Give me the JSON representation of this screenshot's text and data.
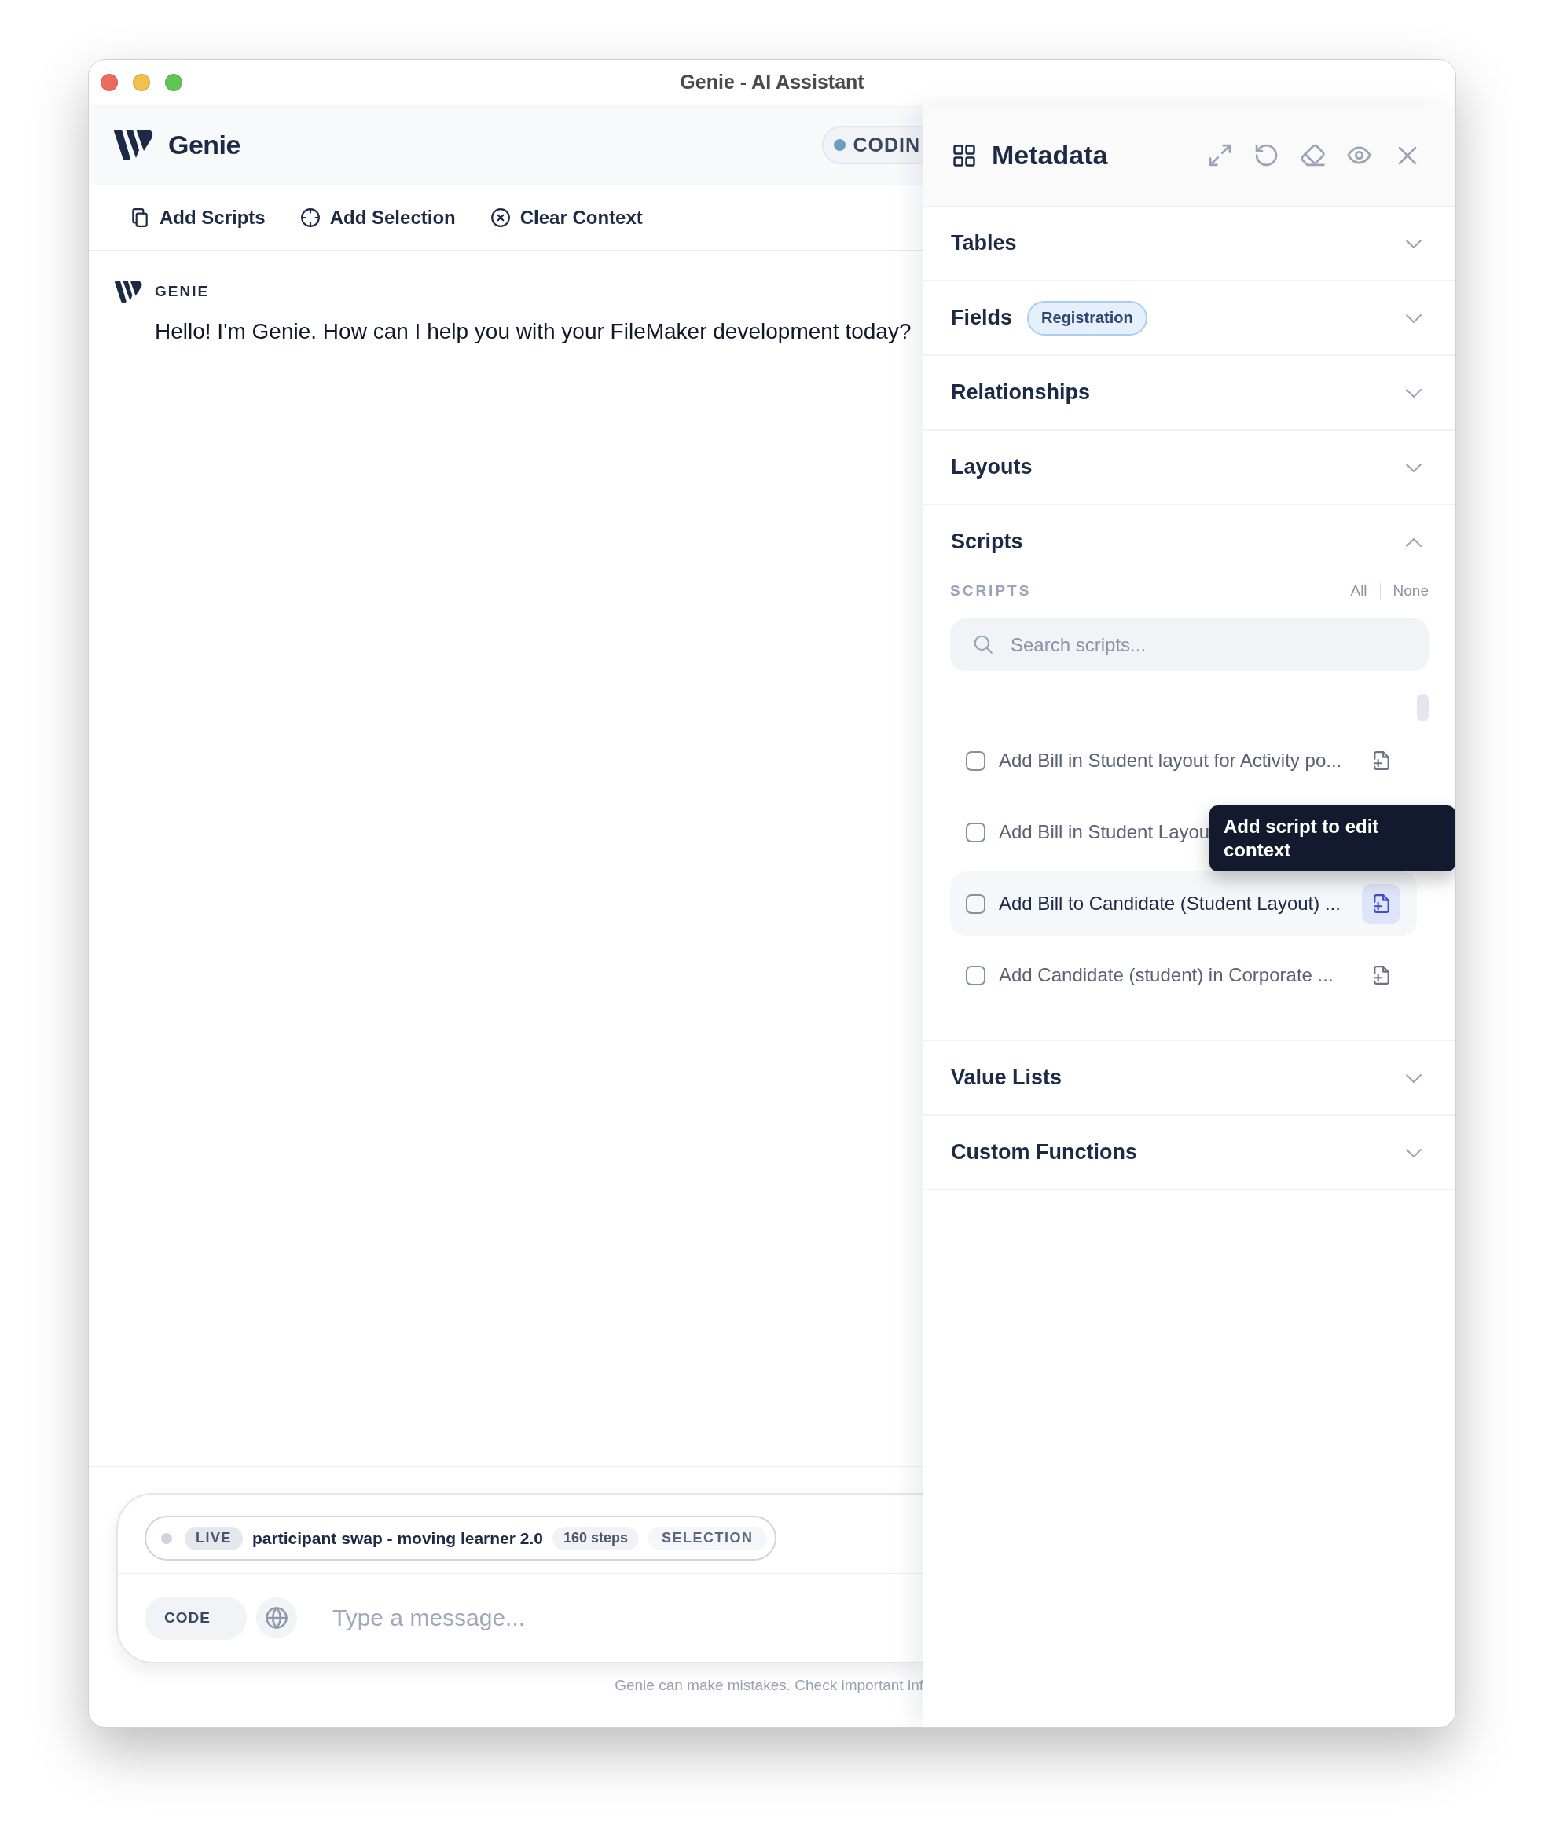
{
  "window": {
    "title": "Genie - AI Assistant"
  },
  "header": {
    "app_name": "Genie",
    "mode_badge": "CODIN"
  },
  "toolbar": [
    {
      "kind": "scripts",
      "label": "Add Scripts"
    },
    {
      "kind": "selection",
      "label": "Add Selection"
    },
    {
      "kind": "clear",
      "label": "Clear Context"
    }
  ],
  "messages": [
    {
      "sender": "GENIE",
      "text": "Hello! I'm Genie. How can I help you with your FileMaker development today?"
    }
  ],
  "composer": {
    "context": {
      "status": "LIVE",
      "name": "participant swap - moving learner 2.0",
      "steps": "160 steps",
      "mode": "SELECTION"
    },
    "mode_button": "CODE",
    "placeholder": "Type a message...",
    "disclaimer": "Genie can make mistakes. Check important inf"
  },
  "metadata_panel": {
    "title": "Metadata",
    "sections": [
      {
        "title": "Tables",
        "expanded": false
      },
      {
        "title": "Fields",
        "badge": "Registration",
        "expanded": false
      },
      {
        "title": "Relationships",
        "expanded": false
      },
      {
        "title": "Layouts",
        "expanded": false
      },
      {
        "title": "Scripts",
        "expanded": true,
        "list_label": "SCRIPTS",
        "select_all": "All",
        "select_none": "None",
        "search": {
          "placeholder": "Search scripts..."
        },
        "items": [
          {
            "name": "Add Bill in Student layout for Activity po...",
            "checked": false,
            "highlighted": false
          },
          {
            "name": "Add Bill in Student Layou",
            "checked": false,
            "highlighted": false
          },
          {
            "name": "Add Bill to Candidate (Student Layout) ...",
            "checked": false,
            "highlighted": true
          },
          {
            "name": "Add Candidate (student) in Corporate ...",
            "checked": false,
            "highlighted": false
          }
        ]
      },
      {
        "title": "Value Lists",
        "expanded": false
      },
      {
        "title": "Custom Functions",
        "expanded": false
      }
    ],
    "tooltip": "Add script to edit context"
  }
}
